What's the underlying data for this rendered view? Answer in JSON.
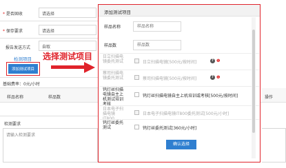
{
  "form": {
    "row1_label": "是否固收",
    "row1_value": "请选择",
    "row2_label": "保存要求",
    "row2_value": "请选择",
    "row3_label": "报告发送方式",
    "row3_value": "自取",
    "section_label": "检测项目",
    "add_button_label": "添加测试项目",
    "base_fee": "基础费率：0元/小时",
    "table_headers": [
      "样品名称",
      "样品数"
    ],
    "table_header_right": "操作",
    "requirement_label": "检测要求",
    "requirement_placeholder": "请输入检测要求"
  },
  "callout_text": "选择测试项目",
  "modal": {
    "title": "添加测试项目",
    "sample_name_label": "样品名称",
    "sample_name_placeholder": "样品名称",
    "sample_count_label": "样品数",
    "sample_count_placeholder": "样品数",
    "items": [
      {
        "label": "日立扫描电镜委托测试",
        "option": "日立扫描电镜[500元/按时间]",
        "disabled": true,
        "help": true
      },
      {
        "label": "蔡司扫描电镜委托测试",
        "option": "蔡司扫描电镜[500元/按时间]",
        "disabled": true,
        "help": true
      },
      {
        "label": "钨灯丝扫描电镜自主上机测试培训考核",
        "option": "钨灯丝扫描电镜自主上机培训或考核[500元/按时间]",
        "disabled": false,
        "help": false
      },
      {
        "label": "日本电子扫描电镜IT800",
        "option": "日本电子扫描电镜IT800委托测试[500元/小时]",
        "disabled": true,
        "help": false
      },
      {
        "label": "钨灯丝委托测试",
        "option": "钨灯丝委托测试[360元/小时]",
        "disabled": false,
        "help": false
      }
    ],
    "confirm_label": "确认选择"
  },
  "colors": {
    "accent_blue": "#2f7fd0",
    "highlight_red": "#e0232b"
  }
}
